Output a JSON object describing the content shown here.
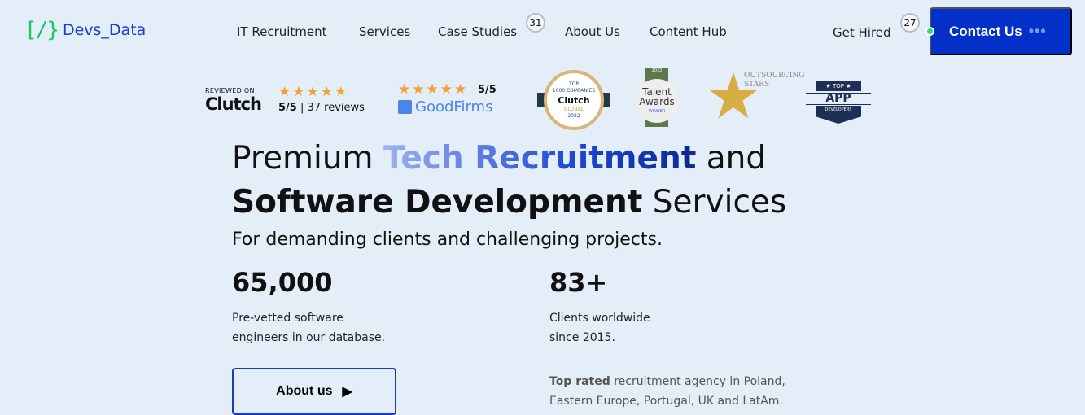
{
  "brand": {
    "name": "Devs_Data",
    "mark": "[/}"
  },
  "nav": [
    {
      "label": "IT Recruitment"
    },
    {
      "label": "Services"
    },
    {
      "label": "Case Studies",
      "badge": "31"
    },
    {
      "label": "About Us"
    },
    {
      "label": "Content Hub"
    }
  ],
  "get_hired": {
    "label": "Get Hired",
    "badge": "27"
  },
  "contact": {
    "label": "Contact Us",
    "dots": "•••"
  },
  "ratings": {
    "clutch": {
      "reviewed_on": "REVIEWED ON",
      "name": "Clutch",
      "stars": "★★★★★",
      "score": "5/5",
      "reviews": "| 37 reviews"
    },
    "goodfirms": {
      "stars": "★★★★★",
      "score": "5/5",
      "name": "GoodFirms"
    }
  },
  "badges": {
    "clutch_top": {
      "top": "TOP",
      "line": "1000 COMPANIES",
      "name": "Clutch",
      "sub": "GLOBAL",
      "year": "2022"
    },
    "talent": {
      "year": "2022",
      "line1": "Talent",
      "line2": "Awards",
      "sub": "WINNER"
    },
    "outsourcing": {
      "line1": "OUTSOURCING",
      "line2": "STARS"
    },
    "app": {
      "top": "TOP",
      "app": "APP",
      "sub": "DEVELOPERS"
    }
  },
  "hero": {
    "t1": "Premium ",
    "t2": "Tech Recruitment",
    "t3": " and",
    "t4": "Software Development",
    "t5": " Services",
    "subtitle": "For demanding clients and challenging projects."
  },
  "stats": [
    {
      "value": "65,000",
      "l1": "Pre-vetted software",
      "l2": "engineers in our database."
    },
    {
      "value": "83+",
      "l1": "Clients worldwide",
      "l2": "since 2015."
    }
  ],
  "about_button": "About us",
  "top_rated": {
    "bold": "Top rated",
    "rest": " recruitment agency in Poland,",
    "l2": "Eastern Europe, Portugal, UK and LatAm."
  },
  "colors": {
    "accent": "#0230c9",
    "green": "#22c55e",
    "star": "#f5a033",
    "bg": "#e4eef8"
  }
}
